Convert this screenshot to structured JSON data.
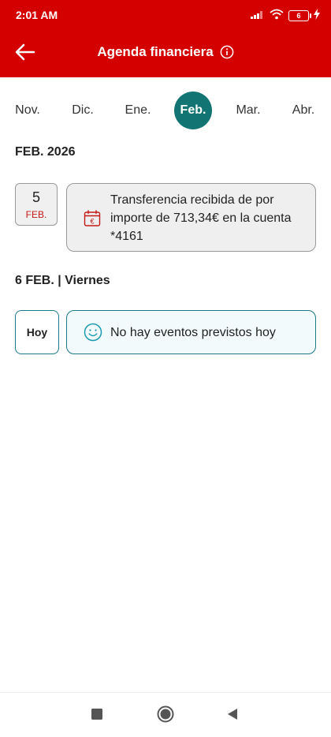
{
  "status_bar": {
    "time": "2:01 AM",
    "battery": "6"
  },
  "app_bar": {
    "title": "Agenda financiera"
  },
  "months": [
    "Nov.",
    "Dic.",
    "Ene.",
    "Feb.",
    "Mar.",
    "Abr."
  ],
  "selected_month": "Feb.",
  "section_month": {
    "title": "FEB. 2026"
  },
  "event": {
    "day": "5",
    "month": "FEB.",
    "description": "Transferencia recibida de  por importe de 713,34€  en la cuenta *4161"
  },
  "section_day": {
    "title": "6 FEB. | Viernes"
  },
  "today": {
    "label": "Hoy",
    "message": "No hay eventos previstos hoy"
  },
  "colors": {
    "header_red": "#d40000",
    "accent_teal": "#137474",
    "date_red": "#c21b17",
    "today_border": "#1b7a88"
  }
}
